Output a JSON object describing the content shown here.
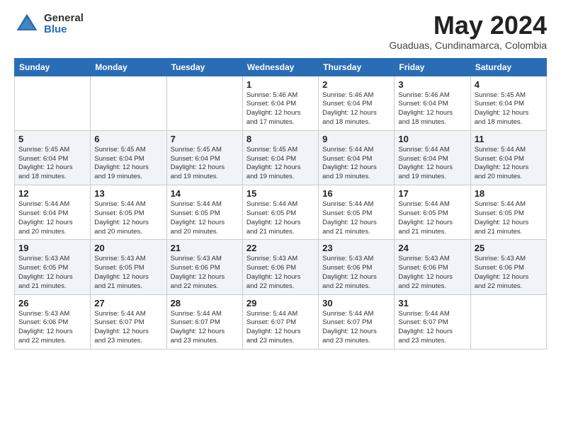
{
  "logo": {
    "general": "General",
    "blue": "Blue"
  },
  "title": "May 2024",
  "subtitle": "Guaduas, Cundinamarca, Colombia",
  "days_header": [
    "Sunday",
    "Monday",
    "Tuesday",
    "Wednesday",
    "Thursday",
    "Friday",
    "Saturday"
  ],
  "weeks": [
    [
      {
        "day": "",
        "text": ""
      },
      {
        "day": "",
        "text": ""
      },
      {
        "day": "",
        "text": ""
      },
      {
        "day": "1",
        "text": "Sunrise: 5:46 AM\nSunset: 6:04 PM\nDaylight: 12 hours\nand 17 minutes."
      },
      {
        "day": "2",
        "text": "Sunrise: 5:46 AM\nSunset: 6:04 PM\nDaylight: 12 hours\nand 18 minutes."
      },
      {
        "day": "3",
        "text": "Sunrise: 5:46 AM\nSunset: 6:04 PM\nDaylight: 12 hours\nand 18 minutes."
      },
      {
        "day": "4",
        "text": "Sunrise: 5:45 AM\nSunset: 6:04 PM\nDaylight: 12 hours\nand 18 minutes."
      }
    ],
    [
      {
        "day": "5",
        "text": "Sunrise: 5:45 AM\nSunset: 6:04 PM\nDaylight: 12 hours\nand 18 minutes."
      },
      {
        "day": "6",
        "text": "Sunrise: 5:45 AM\nSunset: 6:04 PM\nDaylight: 12 hours\nand 19 minutes."
      },
      {
        "day": "7",
        "text": "Sunrise: 5:45 AM\nSunset: 6:04 PM\nDaylight: 12 hours\nand 19 minutes."
      },
      {
        "day": "8",
        "text": "Sunrise: 5:45 AM\nSunset: 6:04 PM\nDaylight: 12 hours\nand 19 minutes."
      },
      {
        "day": "9",
        "text": "Sunrise: 5:44 AM\nSunset: 6:04 PM\nDaylight: 12 hours\nand 19 minutes."
      },
      {
        "day": "10",
        "text": "Sunrise: 5:44 AM\nSunset: 6:04 PM\nDaylight: 12 hours\nand 19 minutes."
      },
      {
        "day": "11",
        "text": "Sunrise: 5:44 AM\nSunset: 6:04 PM\nDaylight: 12 hours\nand 20 minutes."
      }
    ],
    [
      {
        "day": "12",
        "text": "Sunrise: 5:44 AM\nSunset: 6:04 PM\nDaylight: 12 hours\nand 20 minutes."
      },
      {
        "day": "13",
        "text": "Sunrise: 5:44 AM\nSunset: 6:05 PM\nDaylight: 12 hours\nand 20 minutes."
      },
      {
        "day": "14",
        "text": "Sunrise: 5:44 AM\nSunset: 6:05 PM\nDaylight: 12 hours\nand 20 minutes."
      },
      {
        "day": "15",
        "text": "Sunrise: 5:44 AM\nSunset: 6:05 PM\nDaylight: 12 hours\nand 21 minutes."
      },
      {
        "day": "16",
        "text": "Sunrise: 5:44 AM\nSunset: 6:05 PM\nDaylight: 12 hours\nand 21 minutes."
      },
      {
        "day": "17",
        "text": "Sunrise: 5:44 AM\nSunset: 6:05 PM\nDaylight: 12 hours\nand 21 minutes."
      },
      {
        "day": "18",
        "text": "Sunrise: 5:44 AM\nSunset: 6:05 PM\nDaylight: 12 hours\nand 21 minutes."
      }
    ],
    [
      {
        "day": "19",
        "text": "Sunrise: 5:43 AM\nSunset: 6:05 PM\nDaylight: 12 hours\nand 21 minutes."
      },
      {
        "day": "20",
        "text": "Sunrise: 5:43 AM\nSunset: 6:05 PM\nDaylight: 12 hours\nand 21 minutes."
      },
      {
        "day": "21",
        "text": "Sunrise: 5:43 AM\nSunset: 6:06 PM\nDaylight: 12 hours\nand 22 minutes."
      },
      {
        "day": "22",
        "text": "Sunrise: 5:43 AM\nSunset: 6:06 PM\nDaylight: 12 hours\nand 22 minutes."
      },
      {
        "day": "23",
        "text": "Sunrise: 5:43 AM\nSunset: 6:06 PM\nDaylight: 12 hours\nand 22 minutes."
      },
      {
        "day": "24",
        "text": "Sunrise: 5:43 AM\nSunset: 6:06 PM\nDaylight: 12 hours\nand 22 minutes."
      },
      {
        "day": "25",
        "text": "Sunrise: 5:43 AM\nSunset: 6:06 PM\nDaylight: 12 hours\nand 22 minutes."
      }
    ],
    [
      {
        "day": "26",
        "text": "Sunrise: 5:43 AM\nSunset: 6:06 PM\nDaylight: 12 hours\nand 22 minutes."
      },
      {
        "day": "27",
        "text": "Sunrise: 5:44 AM\nSunset: 6:07 PM\nDaylight: 12 hours\nand 23 minutes."
      },
      {
        "day": "28",
        "text": "Sunrise: 5:44 AM\nSunset: 6:07 PM\nDaylight: 12 hours\nand 23 minutes."
      },
      {
        "day": "29",
        "text": "Sunrise: 5:44 AM\nSunset: 6:07 PM\nDaylight: 12 hours\nand 23 minutes."
      },
      {
        "day": "30",
        "text": "Sunrise: 5:44 AM\nSunset: 6:07 PM\nDaylight: 12 hours\nand 23 minutes."
      },
      {
        "day": "31",
        "text": "Sunrise: 5:44 AM\nSunset: 6:07 PM\nDaylight: 12 hours\nand 23 minutes."
      },
      {
        "day": "",
        "text": ""
      }
    ]
  ]
}
